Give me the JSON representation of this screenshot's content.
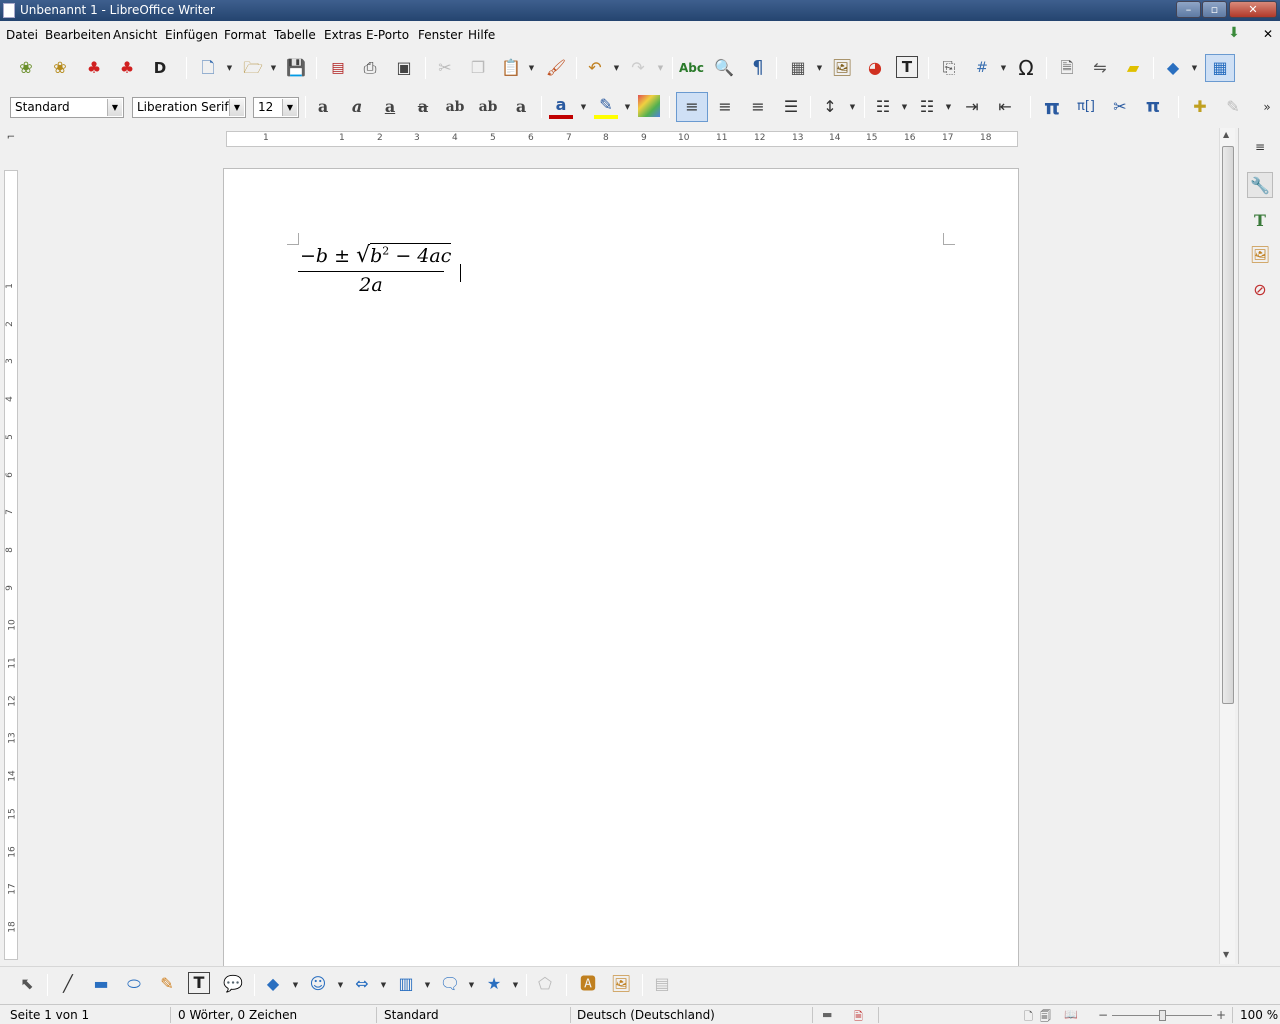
{
  "window": {
    "title": "Unbenannt 1 - LibreOffice Writer",
    "controls": [
      "–",
      "▫",
      "✕"
    ]
  },
  "menu": {
    "items": [
      "Datei",
      "Bearbeiten",
      "Ansicht",
      "Einfügen",
      "Format",
      "Tabelle",
      "Extras",
      "E-Porto",
      "Fenster",
      "Hilfe"
    ],
    "close": "✕"
  },
  "formatting": {
    "style": "Standard",
    "font": "Liberation Serif",
    "size": "12"
  },
  "ruler": {
    "h": [
      "1",
      "1",
      "2",
      "3",
      "4",
      "5",
      "6",
      "7",
      "8",
      "9",
      "10",
      "11",
      "12",
      "13",
      "14",
      "15",
      "16",
      "17",
      "18"
    ],
    "v": [
      "1",
      "2",
      "3",
      "4",
      "5",
      "6",
      "7",
      "8",
      "9",
      "10",
      "11",
      "12",
      "13",
      "14",
      "15",
      "16",
      "17",
      "18"
    ]
  },
  "document": {
    "formula": {
      "numerator_a": "−b ±",
      "numerator_b": "b",
      "exponent": "2",
      "numerator_c": " − 4ac",
      "denominator": "2a"
    }
  },
  "status": {
    "page": "Seite 1 von 1",
    "words": "0 Wörter, 0 Zeichen",
    "page_style": "Standard",
    "language": "Deutsch (Deutschland)",
    "zoom": "100 %",
    "zoom_level": 1.0
  },
  "colors": {
    "titlebar": "#24446f",
    "font_color": "#c00000",
    "highlight": "#ffff00"
  }
}
